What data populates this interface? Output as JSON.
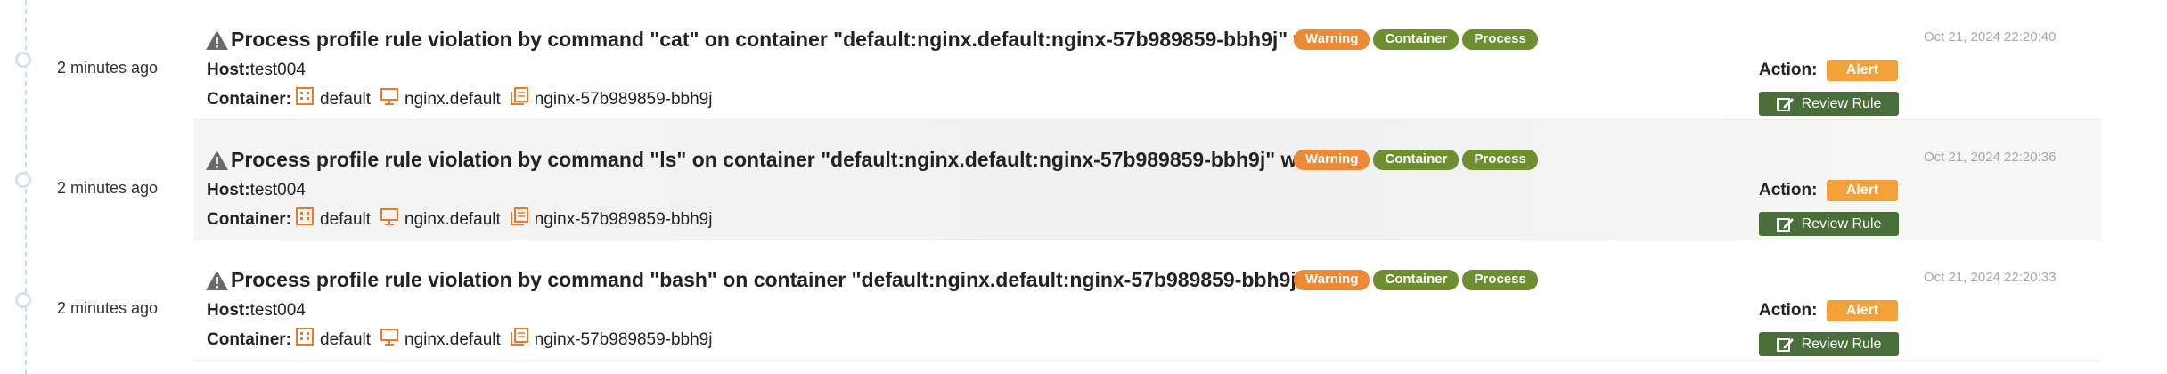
{
  "colors": {
    "warning": "#ee8a35",
    "tag_green": "#6d8f30",
    "alert": "#f4a13a",
    "review_button": "#4a6e3a",
    "timeline": "#c6dcef",
    "icon_orange": "#e87b2c"
  },
  "icons": {
    "title": "warning-triangle-icon",
    "namespace": "building-icon",
    "workload": "monitor-icon",
    "pod": "document-stack-icon",
    "review": "edit-icon"
  },
  "events": [
    {
      "time_ago": "2 minutes ago",
      "title": "Process profile rule violation by command \"cat\" on container \"default:nginx.default:nginx-57b989859-bbh9j\" wa...",
      "badges": [
        "Warning",
        "Container",
        "Process"
      ],
      "timestamp": "Oct 21, 2024 22:20:40",
      "host_label": "Host:",
      "host_value": "test004",
      "container_label": "Container:",
      "namespace": "default",
      "workload": "nginx.default",
      "pod": "nginx-57b989859-bbh9j",
      "action_label": "Action:",
      "action_value": "Alert",
      "review_label": "Review Rule"
    },
    {
      "time_ago": "2 minutes ago",
      "title": "Process profile rule violation by command \"ls\" on container \"default:nginx.default:nginx-57b989859-bbh9j\" was...",
      "badges": [
        "Warning",
        "Container",
        "Process"
      ],
      "timestamp": "Oct 21, 2024 22:20:36",
      "host_label": "Host:",
      "host_value": "test004",
      "container_label": "Container:",
      "namespace": "default",
      "workload": "nginx.default",
      "pod": "nginx-57b989859-bbh9j",
      "action_label": "Action:",
      "action_value": "Alert",
      "review_label": "Review Rule"
    },
    {
      "time_ago": "2 minutes ago",
      "title": "Process profile rule violation by command \"bash\" on container \"default:nginx.default:nginx-57b989859-bbh9j\" ...",
      "badges": [
        "Warning",
        "Container",
        "Process"
      ],
      "timestamp": "Oct 21, 2024 22:20:33",
      "host_label": "Host:",
      "host_value": "test004",
      "container_label": "Container:",
      "namespace": "default",
      "workload": "nginx.default",
      "pod": "nginx-57b989859-bbh9j",
      "action_label": "Action:",
      "action_value": "Alert",
      "review_label": "Review Rule"
    }
  ]
}
